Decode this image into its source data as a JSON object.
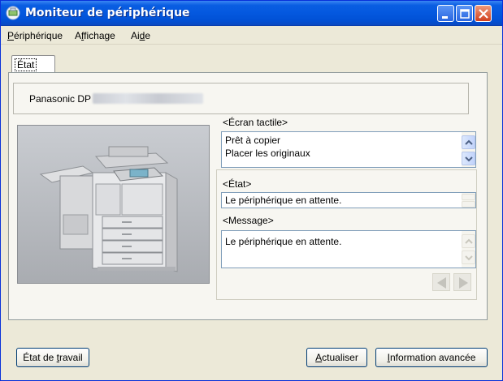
{
  "window": {
    "title": "Moniteur de périphérique"
  },
  "menu": {
    "items": [
      {
        "label": "Périphérique",
        "accel_index": 0
      },
      {
        "label": "Affichage",
        "accel_index": 1
      },
      {
        "label": "Aide",
        "accel_index": 2
      }
    ]
  },
  "tabs": [
    {
      "label": "État",
      "selected": true
    }
  ],
  "device": {
    "name_prefix": "Panasonic DP"
  },
  "touch_panel": {
    "label": "<Écran tactile>",
    "lines": [
      "Prêt à copier",
      "Placer les originaux"
    ]
  },
  "status": {
    "label": "<État>",
    "value": "Le périphérique en attente."
  },
  "message": {
    "label": "<Message>",
    "value": "Le périphérique en attente."
  },
  "buttons": {
    "job_status": {
      "before": "État de ",
      "accel": "t",
      "after": "ravail"
    },
    "refresh": {
      "before": "",
      "accel": "A",
      "after": "ctualiser"
    },
    "advanced": {
      "before": "",
      "accel": "I",
      "after": "nformation avancée"
    }
  },
  "icons": {
    "title": "monitor-icon",
    "minimize": "minimize-icon",
    "maximize": "maximize-icon",
    "close": "close-icon",
    "scroll_up": "chevron-up-icon",
    "scroll_down": "chevron-down-icon",
    "prev": "triangle-left-icon",
    "next": "triangle-right-icon"
  },
  "colors": {
    "titlebar": "#0458df",
    "window_bg": "#ece9d8",
    "close_btn": "#d1401e"
  }
}
